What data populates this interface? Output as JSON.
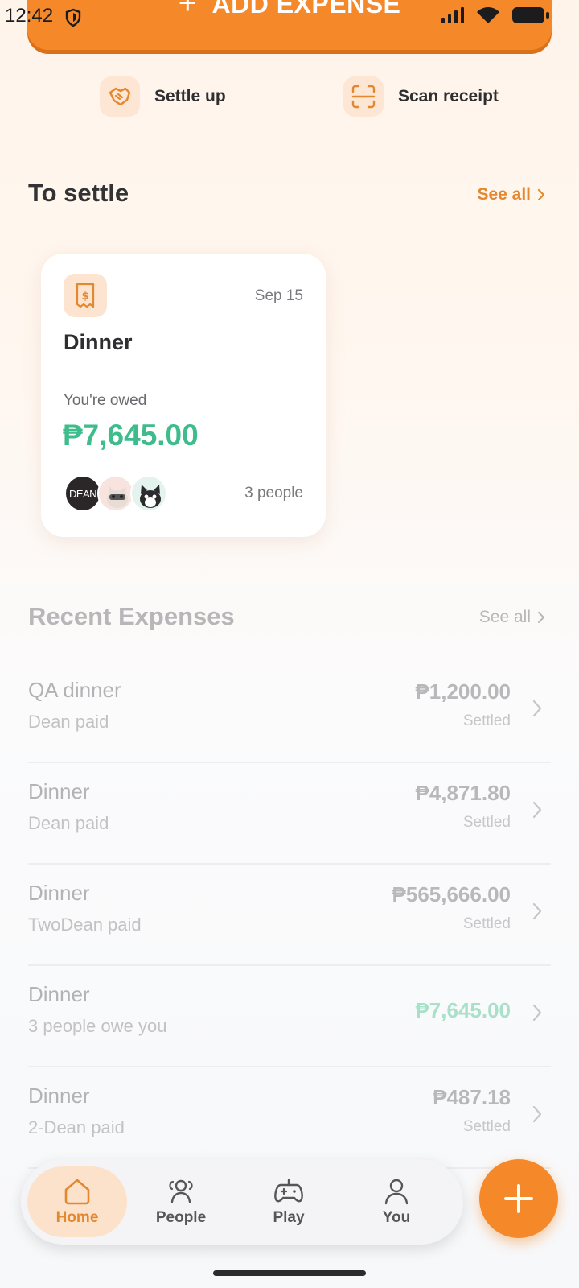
{
  "status_bar": {
    "time": "12:42"
  },
  "header": {
    "add_expense_label": "ADD EXPENSE"
  },
  "quick_actions": {
    "settle_up": "Settle up",
    "scan_receipt": "Scan receipt"
  },
  "to_settle": {
    "title": "To settle",
    "see_all": "See all",
    "card": {
      "date": "Sep 15",
      "name": "Dinner",
      "owed_label": "You're owed",
      "amount": "₱7,645.00",
      "avatar_dean_text": "DEAN",
      "people": "3 people"
    }
  },
  "recent": {
    "title": "Recent Expenses",
    "see_all": "See all",
    "items": [
      {
        "name": "QA dinner",
        "sub": "Dean paid",
        "amount": "₱1,200.00",
        "status": "Settled"
      },
      {
        "name": "Dinner",
        "sub": "Dean paid",
        "amount": "₱4,871.80",
        "status": "Settled"
      },
      {
        "name": "Dinner",
        "sub": "TwoDean paid",
        "amount": "₱565,666.00",
        "status": "Settled"
      },
      {
        "name": "Dinner",
        "sub": "3 people owe you",
        "amount": "₱7,645.00",
        "status": ""
      },
      {
        "name": "Dinner",
        "sub": "2-Dean paid",
        "amount": "₱487.18",
        "status": "Settled"
      }
    ]
  },
  "nav": {
    "home": "Home",
    "people": "People",
    "play": "Play",
    "you": "You"
  },
  "colors": {
    "accent": "#f5892a",
    "owed_green": "#3fbc8c"
  }
}
